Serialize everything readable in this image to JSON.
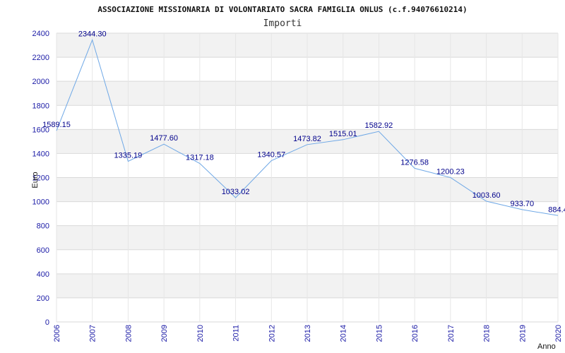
{
  "chart_data": {
    "type": "line",
    "title": "ASSOCIAZIONE MISSIONARIA DI VOLONTARIATO SACRA FAMIGLIA ONLUS (c.f.94076610214)",
    "subtitle": "Importi",
    "xlabel": "Anno",
    "ylabel": "Euro",
    "categories": [
      "2006",
      "2007",
      "2008",
      "2009",
      "2010",
      "2011",
      "2012",
      "2013",
      "2014",
      "2015",
      "2016",
      "2017",
      "2018",
      "2019",
      "2020"
    ],
    "series": [
      {
        "values": [
          1589.15,
          2344.3,
          1335.19,
          1477.6,
          1317.18,
          1033.02,
          1340.57,
          1473.82,
          1515.01,
          1582.92,
          1276.58,
          1200.23,
          1003.6,
          933.7,
          884.4
        ],
        "labels": [
          "1589.15",
          "2344.30",
          "1335.19",
          "1477.60",
          "1317.18",
          "1033.02",
          "1340.57",
          "1473.82",
          "1515.01",
          "1582.92",
          "1276.58",
          "1200.23",
          "1003.60",
          "933.70",
          "884.4"
        ]
      }
    ],
    "yticks": [
      "0",
      "200",
      "400",
      "600",
      "800",
      "1000",
      "1200",
      "1400",
      "1600",
      "1800",
      "2000",
      "2200",
      "2400"
    ],
    "ylim": [
      0,
      2400
    ],
    "grid": true,
    "line_color": "#6fa8e6",
    "band_color": "#f2f2f2"
  }
}
